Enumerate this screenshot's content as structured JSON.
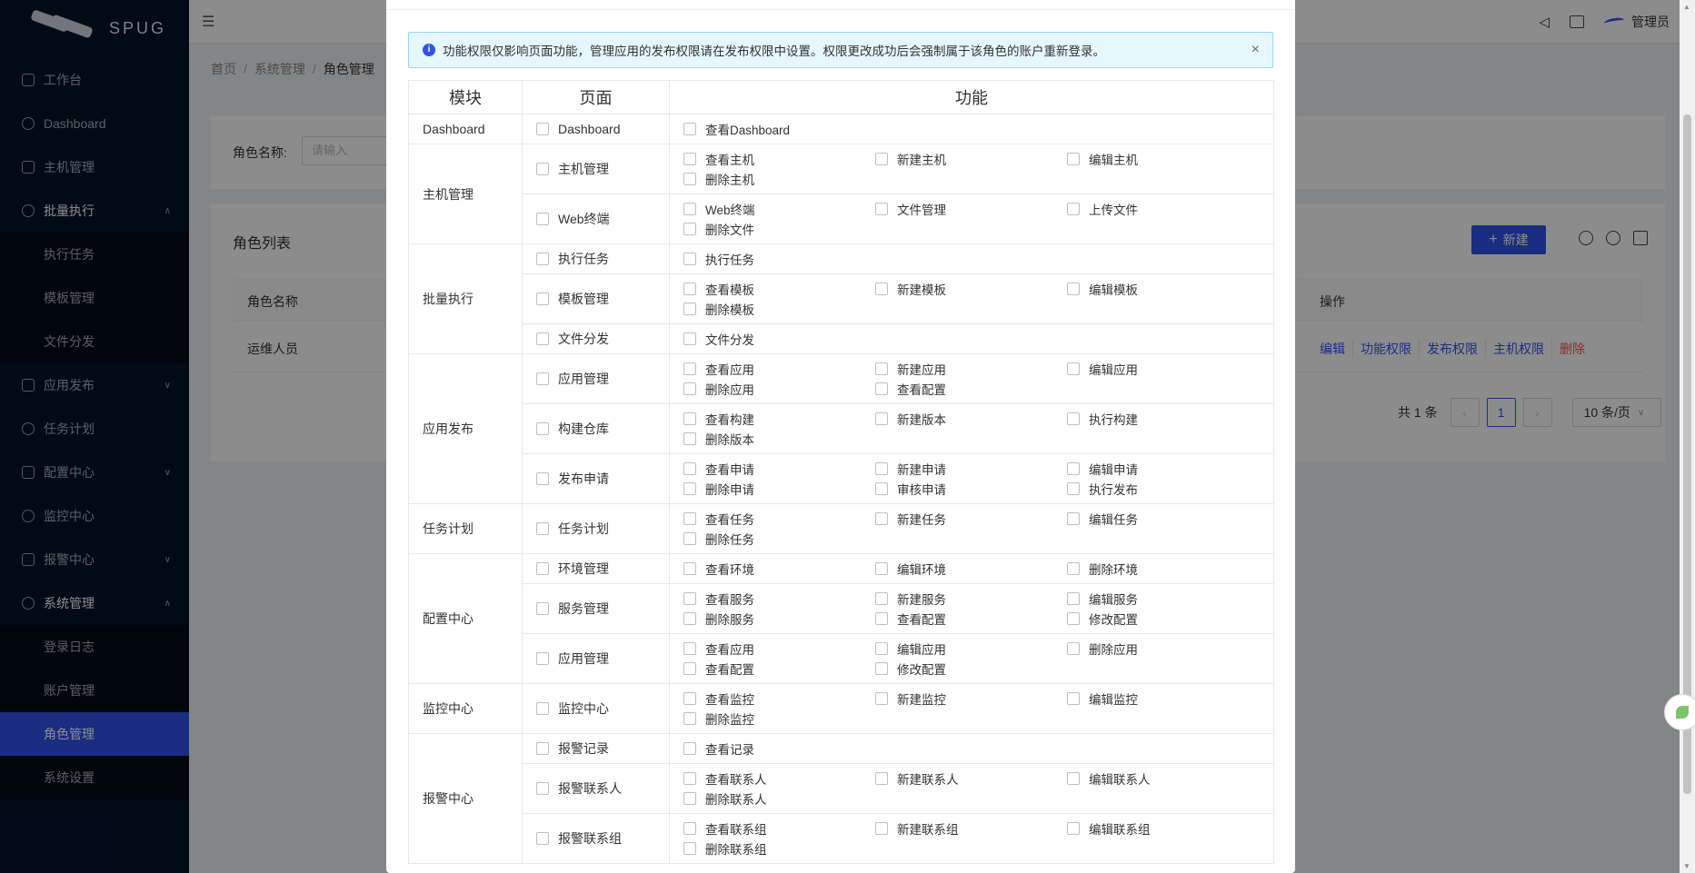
{
  "app": {
    "brand": "SPUG"
  },
  "sidebar": {
    "items": [
      {
        "label": "工作台",
        "icon": "desktop-icon"
      },
      {
        "label": "Dashboard",
        "icon": "dashboard-icon"
      },
      {
        "label": "主机管理",
        "icon": "cloud-server-icon"
      },
      {
        "label": "批量执行",
        "icon": "code-icon",
        "children": [
          "执行任务",
          "模板管理",
          "文件分发"
        ]
      },
      {
        "label": "应用发布",
        "icon": "flag-icon"
      },
      {
        "label": "任务计划",
        "icon": "schedule-icon"
      },
      {
        "label": "配置中心",
        "icon": "deployment-icon"
      },
      {
        "label": "监控中心",
        "icon": "monitor-icon"
      },
      {
        "label": "报警中心",
        "icon": "alert-icon"
      },
      {
        "label": "系统管理",
        "icon": "setting-icon",
        "children": [
          "登录日志",
          "账户管理",
          "角色管理",
          "系统设置"
        ]
      }
    ],
    "active": "角色管理"
  },
  "header": {
    "user": "管理员"
  },
  "breadcrumb": [
    "首页",
    "系统管理",
    "角色管理"
  ],
  "search": {
    "label": "角色名称:",
    "placeholder": "请输入"
  },
  "list": {
    "title": "角色列表",
    "new_button": "新建",
    "columns": [
      "角色名称",
      "操作"
    ],
    "rows": [
      {
        "name": "运维人员",
        "actions": [
          "编辑",
          "功能权限",
          "发布权限",
          "主机权限",
          "删除"
        ]
      }
    ],
    "total": "共 1 条",
    "page": "1",
    "page_size": "10 条/页"
  },
  "modal": {
    "alert": "功能权限仅影响页面功能，管理应用的发布权限请在发布权限中设置。权限更改成功后会强制属于该角色的账户重新登录。",
    "headers": [
      "模块",
      "页面",
      "功能"
    ],
    "modules": [
      {
        "name": "Dashboard",
        "pages": [
          {
            "name": "Dashboard",
            "funcs": [
              "查看Dashboard"
            ]
          }
        ]
      },
      {
        "name": "主机管理",
        "pages": [
          {
            "name": "主机管理",
            "funcs": [
              "查看主机",
              "新建主机",
              "编辑主机",
              "删除主机"
            ]
          },
          {
            "name": "Web终端",
            "funcs": [
              "Web终端",
              "文件管理",
              "上传文件",
              "删除文件"
            ]
          }
        ]
      },
      {
        "name": "批量执行",
        "pages": [
          {
            "name": "执行任务",
            "funcs": [
              "执行任务"
            ]
          },
          {
            "name": "模板管理",
            "funcs": [
              "查看模板",
              "新建模板",
              "编辑模板",
              "删除模板"
            ]
          },
          {
            "name": "文件分发",
            "funcs": [
              "文件分发"
            ]
          }
        ]
      },
      {
        "name": "应用发布",
        "pages": [
          {
            "name": "应用管理",
            "funcs": [
              "查看应用",
              "新建应用",
              "编辑应用",
              "删除应用",
              "查看配置"
            ]
          },
          {
            "name": "构建仓库",
            "funcs": [
              "查看构建",
              "新建版本",
              "执行构建",
              "删除版本"
            ]
          },
          {
            "name": "发布申请",
            "funcs": [
              "查看申请",
              "新建申请",
              "编辑申请",
              "删除申请",
              "审核申请",
              "执行发布"
            ]
          }
        ]
      },
      {
        "name": "任务计划",
        "pages": [
          {
            "name": "任务计划",
            "funcs": [
              "查看任务",
              "新建任务",
              "编辑任务",
              "删除任务"
            ]
          }
        ]
      },
      {
        "name": "配置中心",
        "pages": [
          {
            "name": "环境管理",
            "funcs": [
              "查看环境",
              "编辑环境",
              "删除环境"
            ]
          },
          {
            "name": "服务管理",
            "funcs": [
              "查看服务",
              "新建服务",
              "编辑服务",
              "删除服务",
              "查看配置",
              "修改配置"
            ]
          },
          {
            "name": "应用管理",
            "funcs": [
              "查看应用",
              "编辑应用",
              "删除应用",
              "查看配置",
              "修改配置"
            ]
          }
        ]
      },
      {
        "name": "监控中心",
        "pages": [
          {
            "name": "监控中心",
            "funcs": [
              "查看监控",
              "新建监控",
              "编辑监控",
              "删除监控"
            ]
          }
        ]
      },
      {
        "name": "报警中心",
        "pages": [
          {
            "name": "报警记录",
            "funcs": [
              "查看记录"
            ]
          },
          {
            "name": "报警联系人",
            "funcs": [
              "查看联系人",
              "新建联系人",
              "编辑联系人",
              "删除联系人"
            ]
          },
          {
            "name": "报警联系组",
            "funcs": [
              "查看联系组",
              "新建联系组",
              "编辑联系组",
              "删除联系组"
            ]
          }
        ]
      }
    ]
  }
}
